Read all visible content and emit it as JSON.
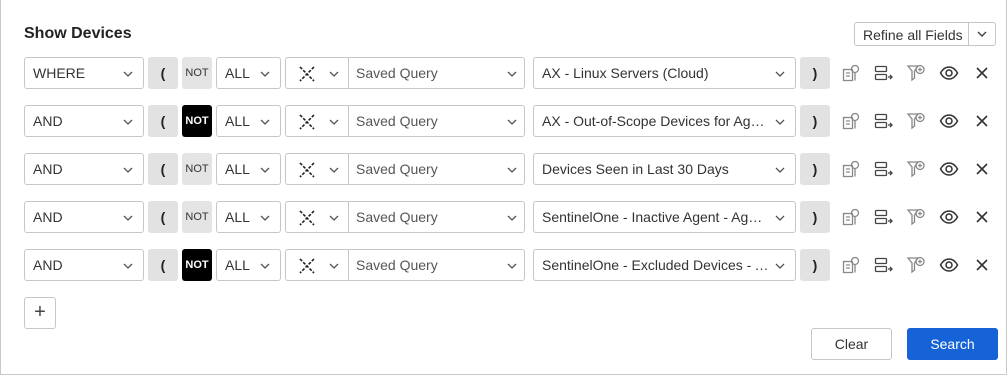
{
  "header": {
    "title": "Show Devices",
    "refine_label": "Refine all Fields"
  },
  "rows": [
    {
      "logic": "WHERE",
      "open_paren": "(",
      "not_label": "NOT",
      "not_active": false,
      "quantifier": "ALL",
      "field_type": "Saved Query",
      "value": "AX - Linux Servers (Cloud)",
      "close_paren": ")"
    },
    {
      "logic": "AND",
      "open_paren": "(",
      "not_label": "NOT",
      "not_active": true,
      "quantifier": "ALL",
      "field_type": "Saved Query",
      "value": "AX - Out-of-Scope Devices for Agen...",
      "close_paren": ")"
    },
    {
      "logic": "AND",
      "open_paren": "(",
      "not_label": "NOT",
      "not_active": false,
      "quantifier": "ALL",
      "field_type": "Saved Query",
      "value": "Devices Seen in Last 30 Days",
      "close_paren": ")"
    },
    {
      "logic": "AND",
      "open_paren": "(",
      "not_label": "NOT",
      "not_active": false,
      "quantifier": "ALL",
      "field_type": "Saved Query",
      "value": "SentinelOne - Inactive Agent - Agen...",
      "close_paren": ")"
    },
    {
      "logic": "AND",
      "open_paren": "(",
      "not_label": "NOT",
      "not_active": true,
      "quantifier": "ALL",
      "field_type": "Saved Query",
      "value": "SentinelOne - Excluded Devices - A...",
      "close_paren": ")"
    }
  ],
  "footer": {
    "add_label": "+",
    "clear_label": "Clear",
    "search_label": "Search"
  },
  "colors": {
    "primary": "#1563d6",
    "not_active_bg": "#000000",
    "paren_bg": "#e2e2e2"
  }
}
